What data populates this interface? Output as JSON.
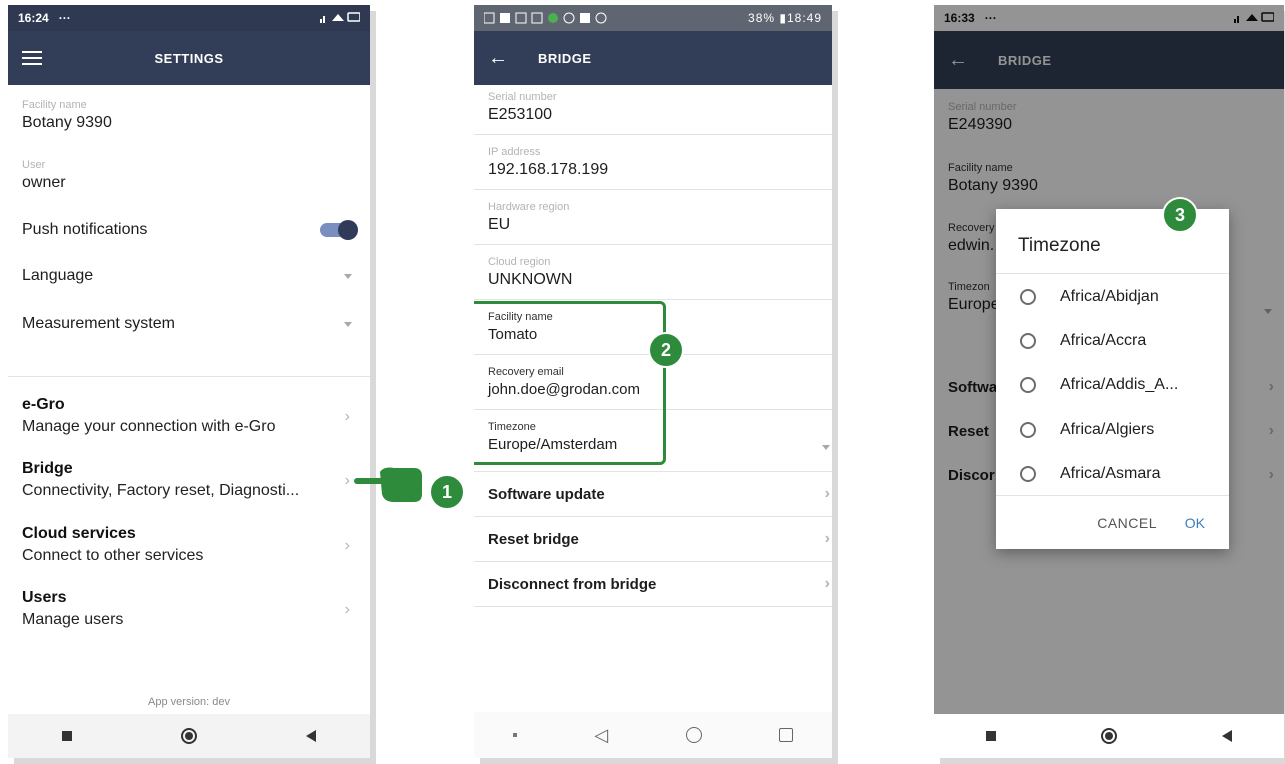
{
  "colors": {
    "header": "#323e57",
    "accent_green": "#2e8b3c",
    "dialog_ok": "#3a7fc4"
  },
  "phone1": {
    "status_time": "16:24",
    "status_dots": "···",
    "title": "SETTINGS",
    "facility_label": "Facility name",
    "facility_value": "Botany 9390",
    "user_label": "User",
    "user_value": "owner",
    "push_label": "Push notifications",
    "language_label": "Language",
    "measurement_label": "Measurement system",
    "menu": [
      {
        "title": "e-Gro",
        "subtitle": "Manage your connection with e-Gro"
      },
      {
        "title": "Bridge",
        "subtitle": "Connectivity, Factory reset, Diagnosti..."
      },
      {
        "title": "Cloud services",
        "subtitle": "Connect to other services"
      },
      {
        "title": "Users",
        "subtitle": "Manage users"
      }
    ],
    "app_version": "App version: dev"
  },
  "phone2": {
    "status_right": "38% ▮18:49",
    "title": "BRIDGE",
    "fields": [
      {
        "label": "Serial number",
        "value": "E253100"
      },
      {
        "label": "IP address",
        "value": "192.168.178.199"
      },
      {
        "label": "Hardware region",
        "value": "EU"
      },
      {
        "label": "Cloud region",
        "value": "UNKNOWN"
      },
      {
        "label": "Facility name",
        "value": "Tomato"
      },
      {
        "label": "Recovery email",
        "value": "john.doe@grodan.com"
      },
      {
        "label": "Timezone",
        "value": "Europe/Amsterdam"
      }
    ],
    "actions": [
      "Software update",
      "Reset bridge",
      "Disconnect from bridge"
    ]
  },
  "phone3": {
    "status_time": "16:33",
    "status_dots": "···",
    "title": "BRIDGE",
    "bg_fields": [
      {
        "label": "Serial number",
        "value": "E249390"
      },
      {
        "label": "Facility name",
        "value": "Botany 9390"
      },
      {
        "label": "Recovery",
        "value": "edwin."
      },
      {
        "label": "Timezon",
        "value": "Europe"
      }
    ],
    "bg_actions": [
      "Softwa",
      "Reset",
      "Discor"
    ],
    "dialog": {
      "title": "Timezone",
      "options": [
        "Africa/Abidjan",
        "Africa/Accra",
        "Africa/Addis_A...",
        "Africa/Algiers",
        "Africa/Asmara"
      ],
      "cancel": "CANCEL",
      "ok": "OK"
    }
  },
  "badges": [
    "1",
    "2",
    "3"
  ]
}
